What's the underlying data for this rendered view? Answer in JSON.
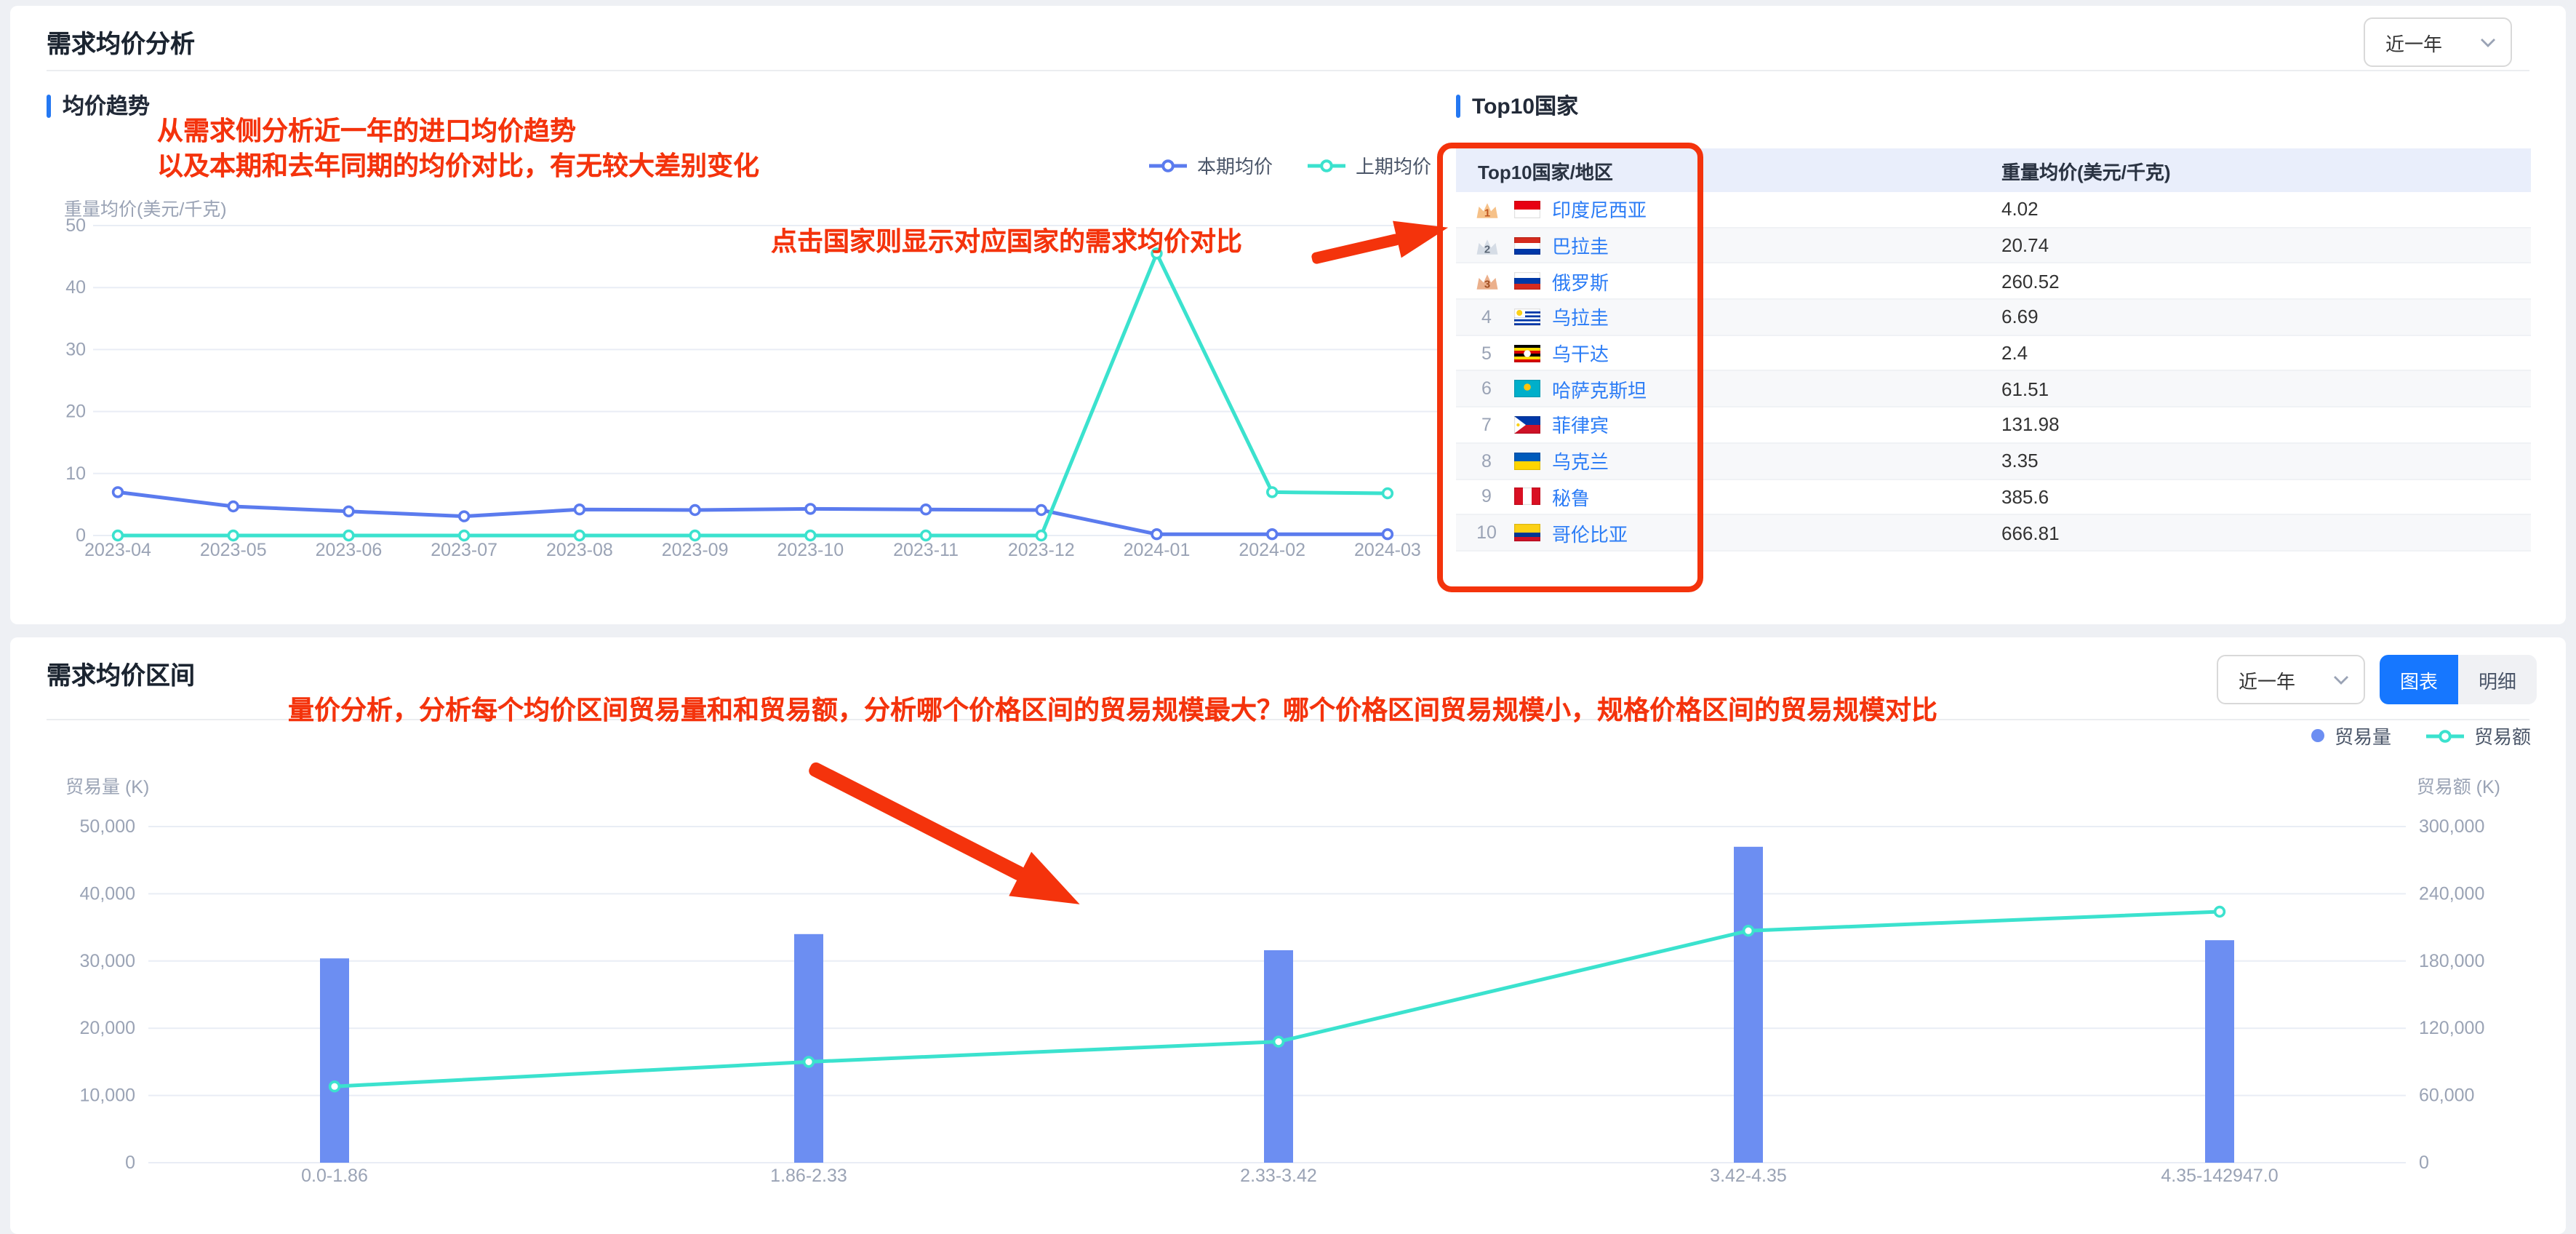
{
  "colors": {
    "accent": "#1677ff",
    "annotation_red": "#f4330c",
    "bar_blue": "#6c8ef2",
    "line_current_blue": "#5b7bee",
    "line_prev_cyan": "#3be2ce",
    "link_blue": "#2b7cf6",
    "table_header_bg": "#e9eefb"
  },
  "card1": {
    "title": "需求均价分析",
    "period_value": "近一年",
    "trend": {
      "section_title": "均价趋势",
      "annotations": [
        "从需求侧分析近一年的进口均价趋势",
        "以及本期和去年同期的均价对比，有无较大差别变化"
      ]
    },
    "top10": {
      "section_title": "Top10国家",
      "annotation": "点击国家则显示对应国家的需求均价对比",
      "columns": [
        "Top10国家/地区",
        "重量均价(美元/千克)"
      ],
      "rows": [
        {
          "rank": 1,
          "country": "印度尼西亚",
          "flag": "indonesia",
          "value": "4.02"
        },
        {
          "rank": 2,
          "country": "巴拉圭",
          "flag": "paraguay",
          "value": "20.74"
        },
        {
          "rank": 3,
          "country": "俄罗斯",
          "flag": "russia",
          "value": "260.52"
        },
        {
          "rank": 4,
          "country": "乌拉圭",
          "flag": "uruguay",
          "value": "6.69"
        },
        {
          "rank": 5,
          "country": "乌干达",
          "flag": "uganda",
          "value": "2.4"
        },
        {
          "rank": 6,
          "country": "哈萨克斯坦",
          "flag": "kazakhstan",
          "value": "61.51"
        },
        {
          "rank": 7,
          "country": "菲律宾",
          "flag": "philippines",
          "value": "131.98"
        },
        {
          "rank": 8,
          "country": "乌克兰",
          "flag": "ukraine",
          "value": "3.35"
        },
        {
          "rank": 9,
          "country": "秘鲁",
          "flag": "peru",
          "value": "385.6"
        },
        {
          "rank": 10,
          "country": "哥伦比亚",
          "flag": "colombia",
          "value": "666.81"
        }
      ]
    }
  },
  "card2": {
    "title": "需求均价区间",
    "annotation": "量价分析，分析每个均价区间贸易量和和贸易额，分析哪个价格区间的贸易规模最大？哪个价格区间贸易规模小，规格价格区间的贸易规模对比",
    "period_value": "近一年",
    "toggle": {
      "chart_label": "图表",
      "detail_label": "明细",
      "active": "图表"
    }
  },
  "chart_data": [
    {
      "type": "line",
      "title": "均价趋势",
      "ylabel": "重量均价(美元/千克)",
      "ylim": [
        0,
        50
      ],
      "grid": true,
      "legend_position": "top",
      "yticks": [
        {
          "v": 0,
          "label": "0"
        },
        {
          "v": 10,
          "label": "10"
        },
        {
          "v": 20,
          "label": "20"
        },
        {
          "v": 30,
          "label": "30"
        },
        {
          "v": 40,
          "label": "40"
        },
        {
          "v": 50,
          "label": "50"
        }
      ],
      "x": [
        "2023-04",
        "2023-05",
        "2023-06",
        "2023-07",
        "2023-08",
        "2023-09",
        "2023-10",
        "2023-11",
        "2023-12",
        "2024-01",
        "2024-02",
        "2024-03"
      ],
      "series": [
        {
          "name": "本期均价",
          "color": "#5b7bee",
          "values": [
            7,
            4.7,
            3.9,
            3.1,
            4.2,
            4.1,
            4.3,
            4.2,
            4.1,
            0.2,
            0.2,
            0.2
          ]
        },
        {
          "name": "上期均价",
          "color": "#3be2ce",
          "values": [
            0,
            0,
            0,
            0,
            0,
            0,
            0,
            0,
            0,
            45.5,
            7,
            6.8
          ]
        }
      ]
    },
    {
      "type": "bar-line",
      "categories": [
        "0.0-1.86",
        "1.86-2.33",
        "2.33-3.42",
        "3.42-4.35",
        "4.35-142947.0"
      ],
      "bar_series": {
        "name": "贸易量",
        "axis": "left",
        "color": "#6c8ef2",
        "values": [
          30400,
          34000,
          31600,
          47000,
          33100
        ]
      },
      "line_series": {
        "name": "贸易额",
        "axis": "right",
        "color": "#3be2ce",
        "values": [
          68000,
          90000,
          108000,
          207000,
          224000
        ]
      },
      "left_axis": {
        "label": "贸易量 (K)",
        "lim": [
          0,
          50000
        ],
        "ticks": [
          {
            "v": 0,
            "label": "0"
          },
          {
            "v": 10000,
            "label": "10,000"
          },
          {
            "v": 20000,
            "label": "20,000"
          },
          {
            "v": 30000,
            "label": "30,000"
          },
          {
            "v": 40000,
            "label": "40,000"
          },
          {
            "v": 50000,
            "label": "50,000"
          }
        ]
      },
      "right_axis": {
        "label": "贸易额 (K)",
        "lim": [
          0,
          300000
        ],
        "ticks": [
          {
            "v": 0,
            "label": "0"
          },
          {
            "v": 60000,
            "label": "60,000"
          },
          {
            "v": 120000,
            "label": "120,000"
          },
          {
            "v": 180000,
            "label": "180,000"
          },
          {
            "v": 240000,
            "label": "240,000"
          },
          {
            "v": 300000,
            "label": "300,000"
          }
        ]
      },
      "grid": true,
      "legend_position": "top-right"
    }
  ]
}
